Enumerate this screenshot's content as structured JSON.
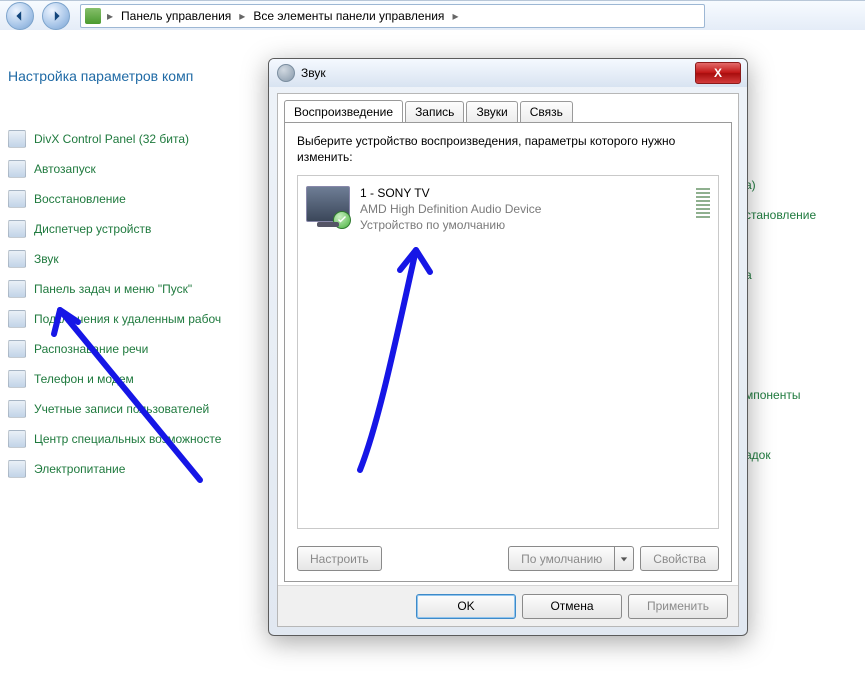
{
  "breadcrumb": {
    "items": [
      "Панель управления",
      "Все элементы панели управления"
    ]
  },
  "page": {
    "heading": "Настройка параметров комп"
  },
  "cp_items": [
    "DivX Control Panel (32 бита)",
    "Автозапуск",
    "Восстановление",
    "Диспетчер устройств",
    "Звук",
    "Панель задач и меню \"Пуск\"",
    "Подключения к удаленным рабоч",
    "Распознавание речи",
    "Телефон и модем",
    "Учетные записи пользователей",
    "Центр специальных возможносте",
    "Электропитание"
  ],
  "right_fragments": {
    "0": "а)",
    "1": "становление",
    "2": "а",
    "3": "мпоненты",
    "4": "адок"
  },
  "dialog": {
    "title": "Звук",
    "close_glyph": "X",
    "tabs": {
      "0": "Воспроизведение",
      "1": "Запись",
      "2": "Звуки",
      "3": "Связь"
    },
    "instruction": "Выберите устройство воспроизведения, параметры которого нужно изменить:",
    "device": {
      "name": "1 - SONY TV",
      "driver": "AMD High Definition Audio Device",
      "status": "Устройство по умолчанию"
    },
    "buttons": {
      "configure": "Настроить",
      "set_default": "По умолчанию",
      "properties": "Свойства",
      "ok": "OK",
      "cancel": "Отмена",
      "apply": "Применить"
    }
  }
}
